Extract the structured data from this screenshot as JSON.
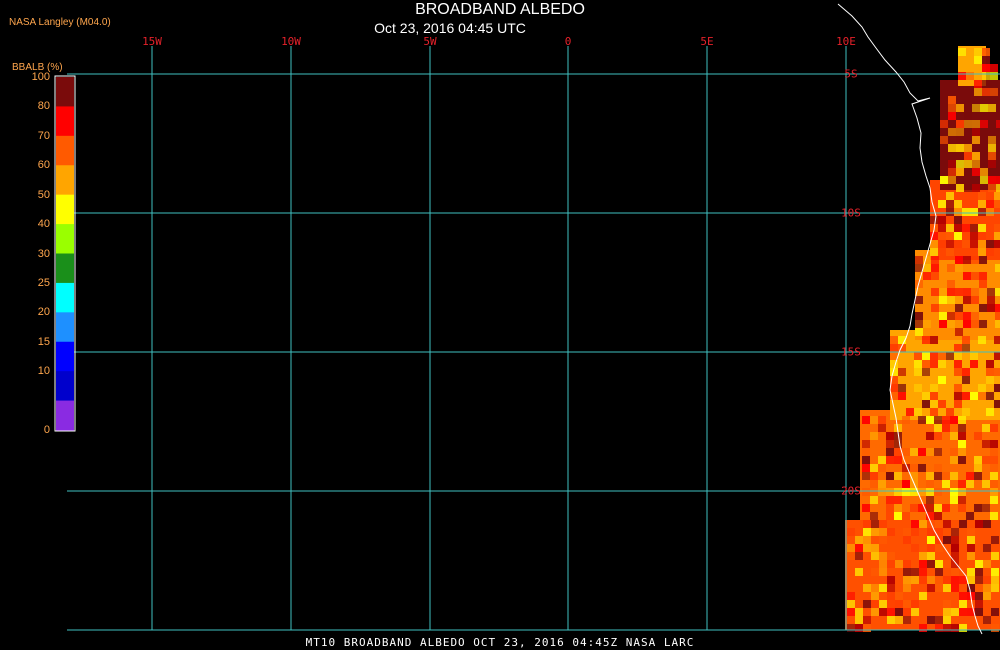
{
  "header": {
    "credit": "NASA Langley (M04.0)",
    "title": "BROADBAND ALBEDO",
    "subtitle": "Oct 23, 2016 04:45 UTC"
  },
  "legend": {
    "title": "BBALB (%)",
    "levels": [
      {
        "label": "100",
        "color": "#7a0b0b"
      },
      {
        "label": "80",
        "color": "#ff0000"
      },
      {
        "label": "70",
        "color": "#ff5a00"
      },
      {
        "label": "60",
        "color": "#ffa500"
      },
      {
        "label": "50",
        "color": "#ffff00"
      },
      {
        "label": "40",
        "color": "#9aff00"
      },
      {
        "label": "30",
        "color": "#1a8f1a"
      },
      {
        "label": "25",
        "color": "#00ffff"
      },
      {
        "label": "20",
        "color": "#1e90ff"
      },
      {
        "label": "15",
        "color": "#0000ff"
      },
      {
        "label": "10",
        "color": "#0000cc"
      },
      {
        "label": "0",
        "color": "#8a2be2"
      }
    ]
  },
  "grid": {
    "color": "#40c0c0",
    "label_color": "#e5212a",
    "longitudes": [
      "15W",
      "10W",
      "5W",
      "0",
      "5E",
      "10E"
    ],
    "latitudes": [
      "5S",
      "10S",
      "15S",
      "20S"
    ]
  },
  "footer": {
    "text": "MT10   BROADBAND ALBEDO   OCT 23, 2016 04:45Z   NASA LARC"
  },
  "map": {
    "region": "Southeast Atlantic / Southwest Africa coast",
    "coastline_color": "#ffffff"
  }
}
